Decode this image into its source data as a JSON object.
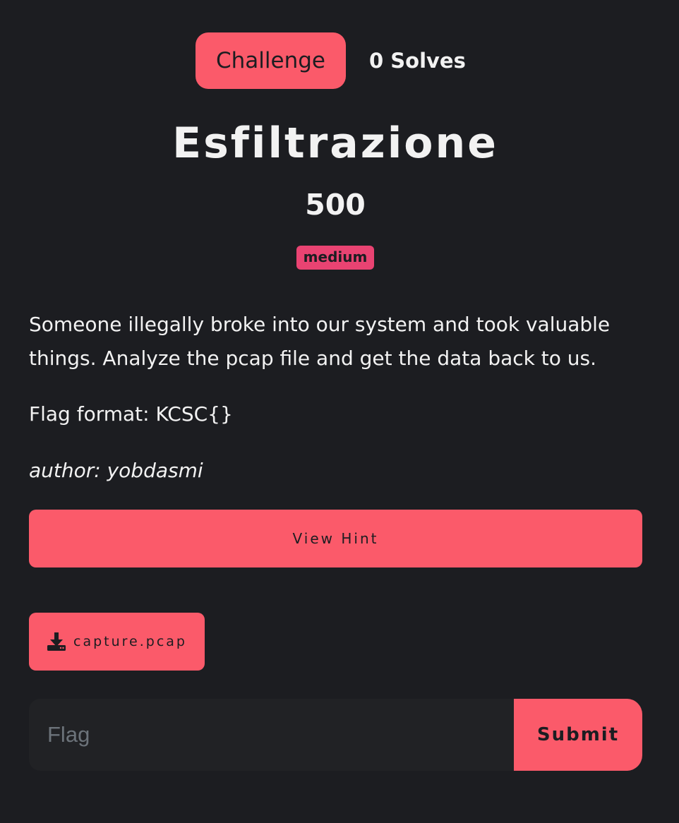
{
  "tabs": {
    "challenge_label": "Challenge",
    "solves_label": "0 Solves"
  },
  "challenge": {
    "name": "Esfiltrazione",
    "points": "500",
    "difficulty": "medium",
    "description": "Someone illegally broke into our system and took valuable things. Analyze the pcap file and get the data back to us.",
    "flag_format": "Flag format: KCSC{}",
    "author": "author: yobdasmi"
  },
  "actions": {
    "hint_label": "View Hint",
    "file_name": "capture.pcap",
    "file_icon": "download-icon"
  },
  "flag_form": {
    "placeholder": "Flag",
    "value": "",
    "submit_label": "Submit"
  },
  "colors": {
    "background": "#1c1d21",
    "accent": "#fb5a6a",
    "badge": "#e94372",
    "input_bg": "#212225"
  }
}
